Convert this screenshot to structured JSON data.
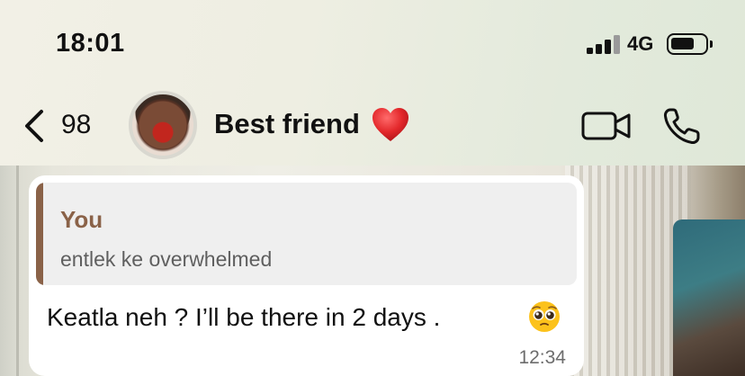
{
  "status_bar": {
    "time": "18:01",
    "network": "4G",
    "signal_icon": "signal-bars-icon",
    "battery_icon": "battery-icon"
  },
  "header": {
    "back_count": "98",
    "chat_name": "Best friend",
    "name_emoji": "red-heart-icon",
    "actions": [
      "video-call-icon",
      "phone-call-icon"
    ]
  },
  "message": {
    "quote": {
      "author": "You",
      "text": "entlek ke overwhelmed"
    },
    "text": "Keatla neh ? I’ll be there in 2  days .",
    "emoji": "pleading-face-icon",
    "time": "12:34"
  },
  "colors": {
    "quote_accent": "#8a6248",
    "bubble": "#ffffff",
    "quote_bg": "#efefef"
  }
}
